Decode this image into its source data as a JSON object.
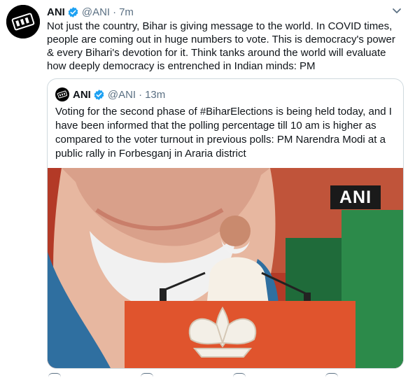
{
  "tweet": {
    "author_name": "ANI",
    "author_handle": "@ANI",
    "separator": "·",
    "time": "7m",
    "text": "Not just the country, Bihar is giving message to the world. In COVID times, people are coming out in huge numbers to vote. This is democracy's power & every Bihari's devotion for it. Think tanks around the world will evaluate how deeply democracy is entrenched in Indian minds: PM"
  },
  "quoted_tweet": {
    "author_name": "ANI",
    "author_handle": "@ANI",
    "separator": "·",
    "time": "13m",
    "text": "Voting for the second phase of #BiharElections is being held today, and I have been informed that the polling percentage till 10 am is higher as compared to the voter turnout in previous polls: PM Narendra Modi at a public rally in Forbesganj in Araria district",
    "media_watermark": "ANI"
  },
  "colors": {
    "verified": "#1da1f2",
    "secondary_text": "#5b7083",
    "border": "#cfd9de"
  }
}
